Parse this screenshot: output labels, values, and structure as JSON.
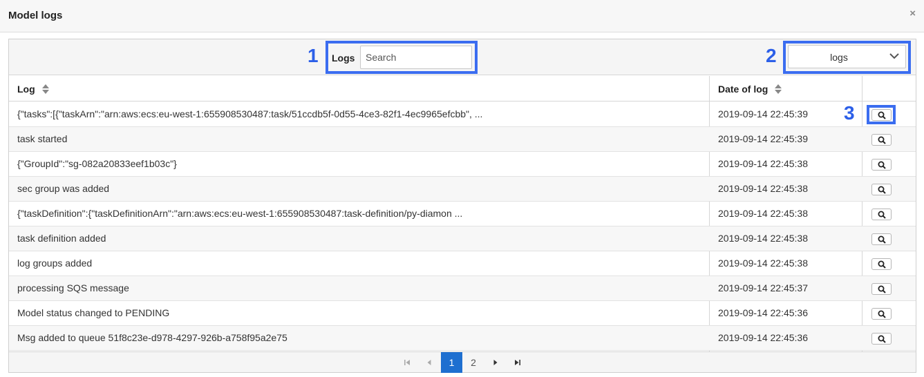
{
  "modal": {
    "title": "Model logs",
    "close_glyph": "×"
  },
  "toolbar": {
    "search_label": "Logs",
    "search_placeholder": "Search",
    "select_value": "logs"
  },
  "annotations": [
    "1",
    "2",
    "3"
  ],
  "columns": {
    "log": "Log",
    "date": "Date of log"
  },
  "rows": [
    {
      "log": "{\"tasks\":[{\"taskArn\":\"arn:aws:ecs:eu-west-1:655908530487:task/51ccdb5f-0d55-4ce3-82f1-4ec9965efcbb\", ...",
      "date": "2019-09-14 22:45:39"
    },
    {
      "log": "task started",
      "date": "2019-09-14 22:45:39"
    },
    {
      "log": "{\"GroupId\":\"sg-082a20833eef1b03c\"}",
      "date": "2019-09-14 22:45:38"
    },
    {
      "log": "sec group was added",
      "date": "2019-09-14 22:45:38"
    },
    {
      "log": "{\"taskDefinition\":{\"taskDefinitionArn\":\"arn:aws:ecs:eu-west-1:655908530487:task-definition/py-diamon ...",
      "date": "2019-09-14 22:45:38"
    },
    {
      "log": "task definition added",
      "date": "2019-09-14 22:45:38"
    },
    {
      "log": "log groups added",
      "date": "2019-09-14 22:45:38"
    },
    {
      "log": "processing SQS message",
      "date": "2019-09-14 22:45:37"
    },
    {
      "log": "Model status changed to PENDING",
      "date": "2019-09-14 22:45:36"
    },
    {
      "log": "Msg added to queue 51f8c23e-d978-4297-926b-a758f95a2e75",
      "date": "2019-09-14 22:45:36"
    }
  ],
  "pagination": {
    "pages": [
      "1",
      "2"
    ],
    "current": "1"
  },
  "icons": {
    "close": "close-icon",
    "dropdown": "chevron-down-icon",
    "sort": "sort-icon",
    "view": "magnifier-icon",
    "first": "first-page-icon",
    "prev": "prev-page-icon",
    "next": "next-page-icon",
    "last": "last-page-icon"
  },
  "colors": {
    "annotation": "#3b6df0",
    "active_page": "#1e6fd0"
  }
}
